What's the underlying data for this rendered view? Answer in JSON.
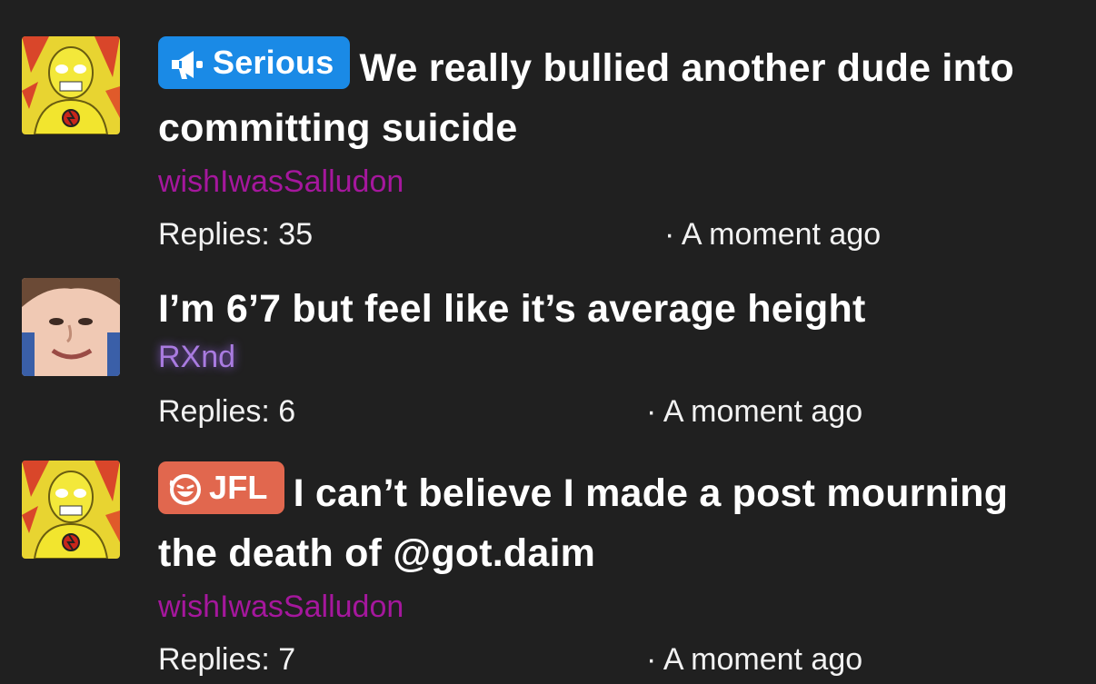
{
  "colors": {
    "background": "#202020",
    "text": "#ffffff",
    "author_magenta": "#a5179d",
    "author_purple": "#a97be0",
    "tag_serious": "#1a8ae6",
    "tag_jfl": "#e1674e"
  },
  "threads": [
    {
      "avatar_icon": "yellow-masked-speedster-avatar",
      "tag": {
        "label": "Serious",
        "icon": "megaphone-icon",
        "color": "#1a8ae6"
      },
      "title": "We really bullied another dude into committing suicide",
      "author": "wishIwasSalludon",
      "author_color": "#a5179d",
      "replies": "Replies: 35",
      "time": "· A moment ago"
    },
    {
      "avatar_icon": "face-photo-avatar",
      "tag": null,
      "title": "I’m 6’7 but feel like it’s average height",
      "author": "RXnd",
      "author_color": "#a97be0",
      "replies": "Replies: 6",
      "time": "· A moment ago"
    },
    {
      "avatar_icon": "yellow-masked-speedster-avatar",
      "tag": {
        "label": "JFL",
        "icon": "laughing-face-icon",
        "color": "#e1674e"
      },
      "title": "I can’t believe I made a post mourning the death of @got.daim",
      "author": "wishIwasSalludon",
      "author_color": "#a5179d",
      "replies": "Replies: 7",
      "time": "· A moment ago"
    }
  ]
}
